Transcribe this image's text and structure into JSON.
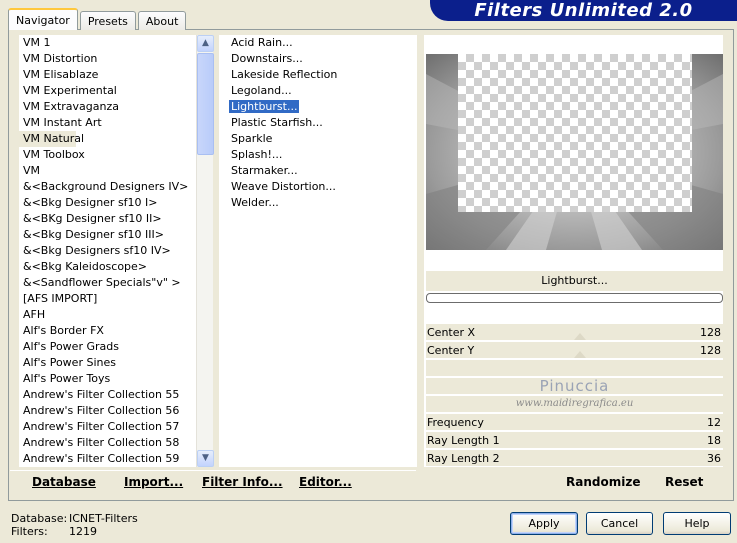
{
  "tabs": [
    {
      "label": "Navigator",
      "active": true
    },
    {
      "label": "Presets",
      "active": false
    },
    {
      "label": "About",
      "active": false
    }
  ],
  "banner_title": "Filters Unlimited 2.0",
  "categories": [
    "VM 1",
    "VM Distortion",
    "VM Elisablaze",
    "VM Experimental",
    "VM Extravaganza",
    "VM Instant Art",
    "VM Natural",
    "VM Toolbox",
    "VM",
    "&<Background Designers IV>",
    "&<Bkg Designer sf10 I>",
    "&<BKg Designer sf10 II>",
    "&<Bkg Designer sf10 III>",
    "&<Bkg Designers sf10 IV>",
    "&<Bkg Kaleidoscope>",
    "&<Sandflower Specials\"v\" >",
    "[AFS IMPORT]",
    "AFH",
    "Alf's Border FX",
    "Alf's Power Grads",
    "Alf's Power Sines",
    "Alf's Power Toys",
    "Andrew's Filter Collection 55",
    "Andrew's Filter Collection 56",
    "Andrew's Filter Collection 57",
    "Andrew's Filter Collection 58",
    "Andrew's Filter Collection 59"
  ],
  "selected_category": "VM Natural",
  "filters": [
    "Acid Rain...",
    "Downstairs...",
    "Lakeside Reflection",
    "Legoland...",
    "Lightburst...",
    "Plastic Starfish...",
    "Sparkle",
    "Splash!...",
    "Starmaker...",
    "Weave Distortion...",
    "Welder..."
  ],
  "selected_filter": "Lightburst...",
  "preview_filter_name": "Lightburst...",
  "controls_top": [
    {
      "label": "Center X",
      "value": "128"
    },
    {
      "label": "Center Y",
      "value": "128"
    }
  ],
  "controls_bottom": [
    {
      "label": "Frequency",
      "value": "12"
    },
    {
      "label": "Ray Length 1",
      "value": "18"
    },
    {
      "label": "Ray Length 2",
      "value": "36"
    }
  ],
  "watermark": {
    "name": "Pinuccia",
    "url": "www.maidiregrafica.eu"
  },
  "bottom_links": {
    "database": "Database",
    "import": "Import...",
    "filter_info": "Filter Info...",
    "editor": "Editor...",
    "randomize": "Randomize",
    "reset": "Reset"
  },
  "footer": {
    "database_label": "Database:",
    "database_value": "ICNET-Filters",
    "filters_label": "Filters:",
    "filters_value": "1219"
  },
  "buttons": {
    "apply": "Apply",
    "cancel": "Cancel",
    "help": "Help"
  },
  "colors": {
    "banner": "#0b1f8c",
    "selection": "#316ac5",
    "tab_highlight": "#ffc83c"
  }
}
